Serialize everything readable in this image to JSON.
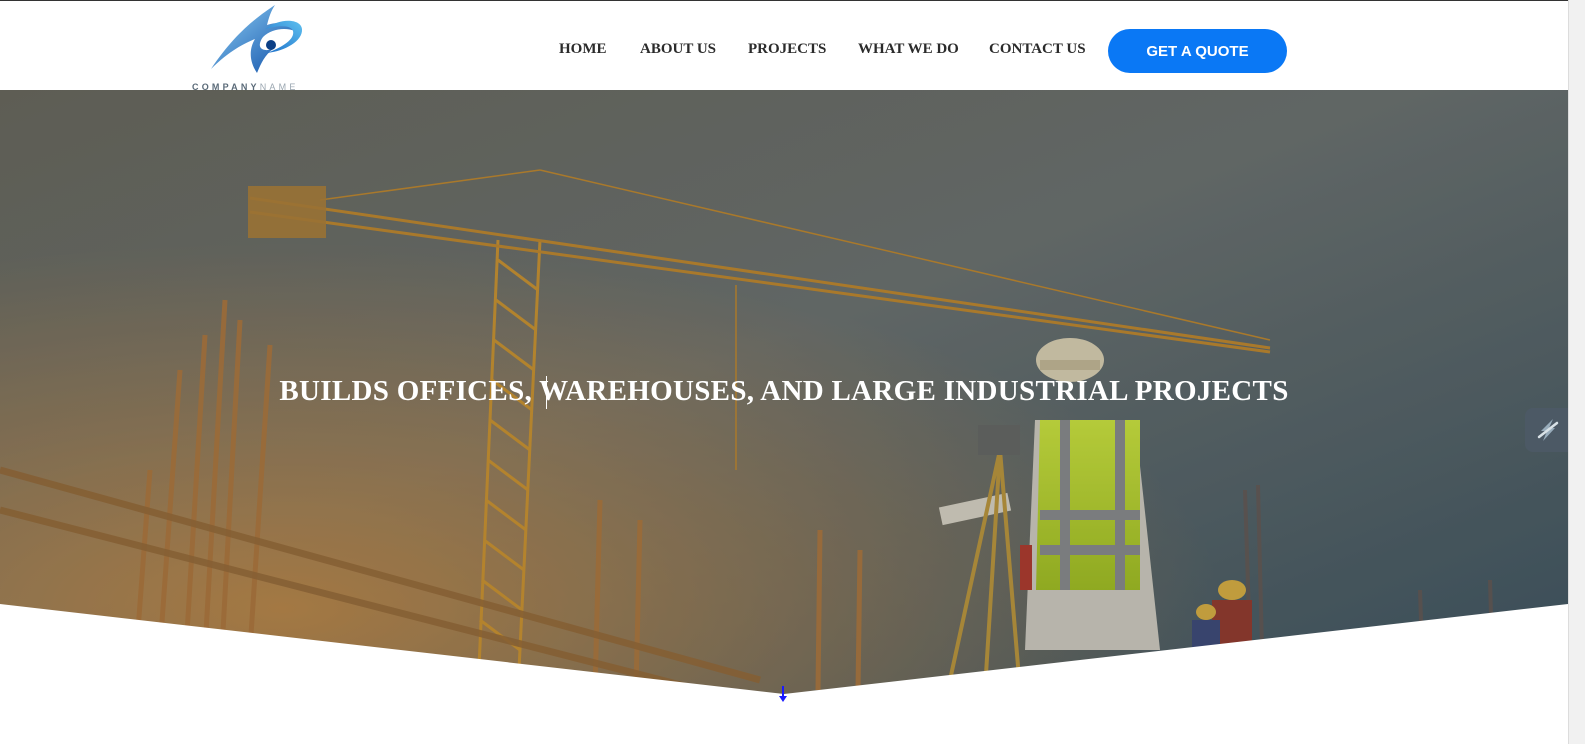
{
  "brand": {
    "name_part1": "COMPANY",
    "name_part2": "NAME",
    "logo_icon": "swoosh-logo-icon"
  },
  "nav": {
    "items": [
      {
        "label": "HOME"
      },
      {
        "label": "ABOUT US"
      },
      {
        "label": "PROJECTS"
      },
      {
        "label": "WHAT WE DO"
      },
      {
        "label": "CONTACT US"
      }
    ],
    "cta_label": "GET A QUOTE"
  },
  "hero": {
    "title": "BUILDS OFFICES, WAREHOUSES, AND LARGE INDUSTRIAL PROJECTS"
  },
  "colors": {
    "accent": "#0a78f5",
    "nav_text": "#2b2b2b",
    "hero_text": "#ffffff",
    "arrow": "#1a1aff"
  },
  "icons": {
    "scroll": "arrow-down-icon",
    "side_widget": "lightning-icon"
  }
}
